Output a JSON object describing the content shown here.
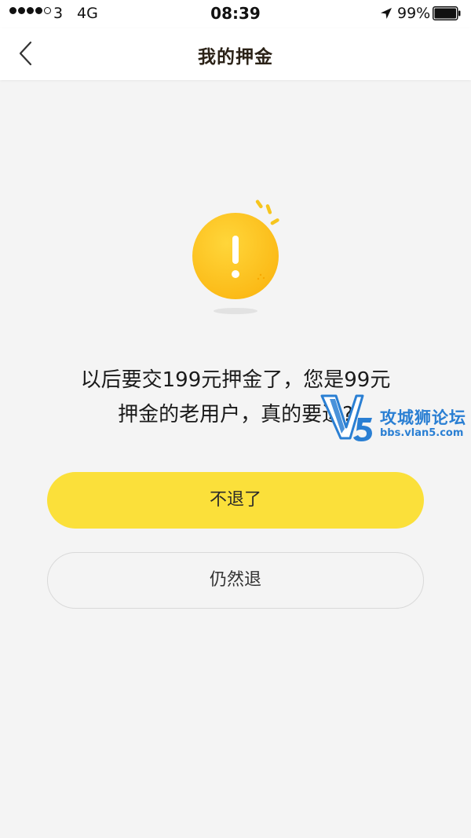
{
  "status_bar": {
    "carrier": "3",
    "network": "4G",
    "time": "08:39",
    "battery": "99%",
    "signal_icon": "signal-dots-icon",
    "location_icon": "location-arrow-icon",
    "battery_icon": "battery-icon"
  },
  "nav": {
    "title": "我的押金",
    "back_icon": "chevron-left-icon"
  },
  "alert": {
    "icon": "exclamation-circle-icon",
    "color": "#fbc21e"
  },
  "message": {
    "line1": "以后要交199元押金了，您是99元",
    "line2": "押金的老用户，真的要退?"
  },
  "buttons": {
    "primary_label": "不退了",
    "secondary_label": "仍然退"
  },
  "watermark": {
    "logo_text": "V5",
    "name": "攻城狮论坛",
    "url": "bbs.vlan5.com"
  },
  "colors": {
    "primary_button": "#fbe03a",
    "background": "#f4f4f4",
    "title_text": "#2b2217",
    "watermark": "#2a7fd3"
  }
}
